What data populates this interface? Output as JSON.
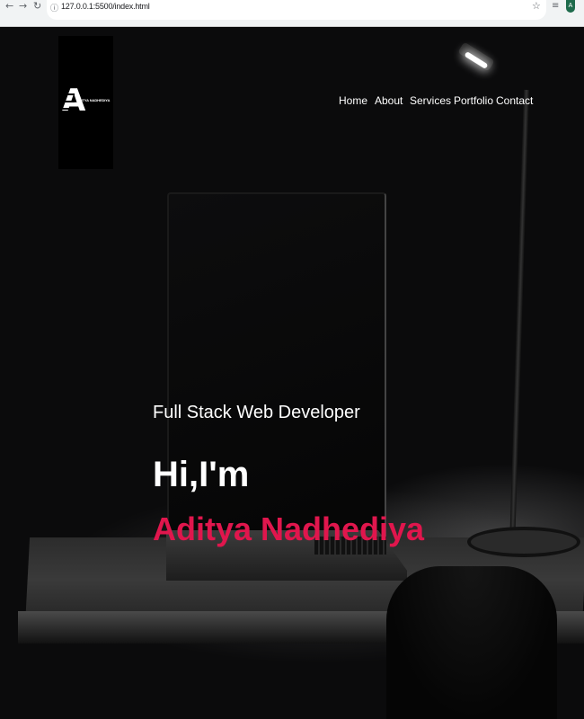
{
  "browser": {
    "url": "127.0.0.1:5500/index.html",
    "back_icon": "arrow-left-icon",
    "forward_icon": "arrow-right-icon",
    "reload_icon": "reload-icon",
    "profile_initial": "A"
  },
  "logo": {
    "text": "ADITYA NADHEDIYA"
  },
  "nav": {
    "items": [
      {
        "label": "Home"
      },
      {
        "label": "About"
      },
      {
        "label": "Services"
      },
      {
        "label": "Portfolio"
      },
      {
        "label": "Contact"
      }
    ]
  },
  "hero": {
    "subtitle": "Full Stack Web Developer",
    "greeting": "Hi,I'm",
    "name": "Aditya Nadhediya",
    "name_color": "#e0164d"
  }
}
